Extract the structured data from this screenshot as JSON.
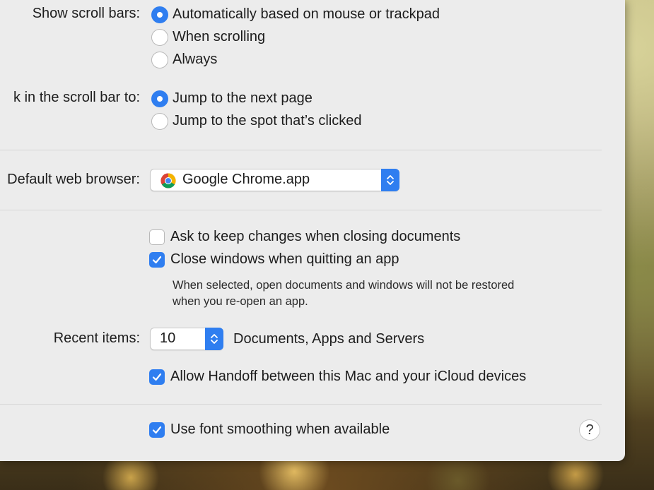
{
  "scroll_bars": {
    "label": "Show scroll bars:",
    "options": [
      {
        "label": "Automatically based on mouse or trackpad",
        "selected": true
      },
      {
        "label": "When scrolling",
        "selected": false
      },
      {
        "label": "Always",
        "selected": false
      }
    ]
  },
  "click_scroll_bar": {
    "label": "k in the scroll bar to:",
    "options": [
      {
        "label": "Jump to the next page",
        "selected": true
      },
      {
        "label": "Jump to the spot that’s clicked",
        "selected": false
      }
    ]
  },
  "browser": {
    "label": "Default web browser:",
    "value": "Google Chrome.app",
    "icon": "chrome-icon"
  },
  "documents": {
    "ask_keep_changes": {
      "label": "Ask to keep changes when closing documents",
      "checked": false
    },
    "close_windows": {
      "label": "Close windows when quitting an app",
      "checked": true
    },
    "note_line1": "When selected, open documents and windows will not be restored",
    "note_line2": "when you re-open an app."
  },
  "recent_items": {
    "label": "Recent items:",
    "value": "10",
    "suffix": "Documents, Apps and Servers"
  },
  "handoff": {
    "label": "Allow Handoff between this Mac and your iCloud devices",
    "checked": true
  },
  "font_smoothing": {
    "label": "Use font smoothing when available",
    "checked": true
  },
  "help": {
    "label": "?"
  },
  "colors": {
    "accent": "#2f7ef0",
    "window_bg": "#ececec",
    "divider": "#d6d6d6"
  }
}
